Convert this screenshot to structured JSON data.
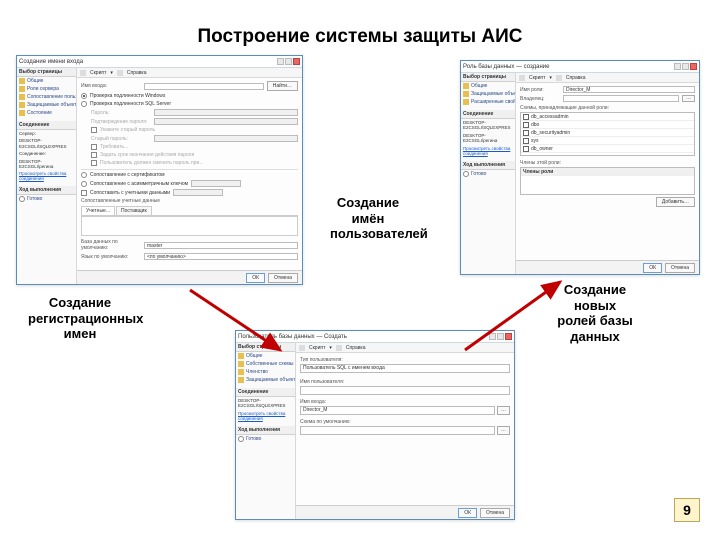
{
  "slide": {
    "title": "Построение системы защиты АИС",
    "page_number": "9"
  },
  "captions": {
    "login_creation": "Создание регистрационных имен",
    "user_creation": "Создание имён пользователей",
    "role_creation": "Создание новых ролей базы данных"
  },
  "buttons": {
    "ok": "ОК",
    "cancel": "Отмена",
    "add": "Добавить…",
    "search": "Найти…",
    "help": "Справка"
  },
  "toolbar": {
    "script": "Скрипт",
    "help_icon": "?"
  },
  "login_window": {
    "title": "Создание имени входа",
    "sidebar_head": "Выбор страницы",
    "sidebar_items": [
      "Общие",
      "Роли сервера",
      "Сопоставление пользователей",
      "Защищаемые объекты",
      "Состояние"
    ],
    "conn_head": "Соединение",
    "server_label": "Сервер:",
    "server_value": "DESKTOP-E2CSGLI\\SQLEXPRES",
    "conn_label": "Соединение:",
    "conn_value": "DESKTOP-E2CSGLI\\регина",
    "view_props": "Просмотреть свойства соединения",
    "progress_head": "Ход выполнения",
    "ready": "Готово",
    "field_login": "Имя входа:",
    "auth_windows": "Проверка подлинности Windows",
    "auth_sql": "Проверка подлинности SQL Server",
    "pwd": "Пароль:",
    "pwd_confirm": "Подтверждение пароля:",
    "pwd_old_chk": "Укажите старый пароль",
    "pwd_old": "Старый пароль:",
    "pwd_policy": "Требовать...",
    "pwd_expire": "Задать срок окончания действия пароля",
    "pwd_change": "Пользователь должен сменить пароль при...",
    "auth_cert": "Сопоставление с сертификатом",
    "auth_asym": "Сопоставление с асимметричным ключом",
    "map_cred": "Сопоставить с учетными данными",
    "mapped_creds": "Сопоставленные учетные данные",
    "col_cred": "Учетные...",
    "col_provider": "Поставщик",
    "default_db": "База данных по умолчанию:",
    "default_db_value": "master",
    "default_lang": "Язык по умолчанию:",
    "default_lang_value": "<по умолчанию>"
  },
  "user_window": {
    "title": "Пользователь базы данных — Создать",
    "sidebar_head": "Выбор страницы",
    "sidebar_items": [
      "Общие",
      "Собственные схемы",
      "Членство",
      "Защищаемые объекты"
    ],
    "field_type": "Тип пользователя:",
    "type_value": "Пользователь SQL с именем входа",
    "field_user": "Имя пользователя:",
    "field_login": "Имя входа:",
    "login_value": "Director_M",
    "field_schema": "Схема по умолчанию:"
  },
  "role_window": {
    "title": "Роль базы данных — создание",
    "sidebar_head": "Выбор страницы",
    "sidebar_items": [
      "Общие",
      "Защищаемые объекты",
      "Расширенные свойства"
    ],
    "conn_value": "DESKTOP-E2CSGLI\\регина",
    "field_role": "Имя роли:",
    "role_value": "Director_M",
    "field_owner": "Владелец:",
    "schemas_head": "Схемы, принадлежащие данной роли:",
    "schemas": [
      "db_accessadmin",
      "dbo",
      "db_securityadmin",
      "sys",
      "db_owner"
    ],
    "members_head": "Члены этой роли:",
    "members_col": "Члены роли"
  }
}
